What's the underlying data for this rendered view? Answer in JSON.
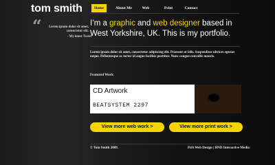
{
  "site": {
    "brand": "tom smith"
  },
  "sidebar": {
    "tweet_quote_icon": "quote-icon",
    "tweet_text": "Lorem ipsum dolor sit amet, consectetur elit.",
    "tweet_author": "- My latest Tweet"
  },
  "nav": {
    "items": [
      {
        "label": "Home",
        "active": true
      },
      {
        "label": "About Me"
      },
      {
        "label": "Web"
      },
      {
        "label": "Print"
      },
      {
        "label": "Contact"
      }
    ]
  },
  "hero": {
    "part1": "I’m a ",
    "highlight1": "graphic",
    "part2": " and ",
    "highlight2": "web designer",
    "part3": " based in West Yorkshire, UK. This is my portfolio."
  },
  "intro": "Lorem ipsum dolor sit amet, consectetur adipiscing elit. Praesent ut felis. Suspendisse ultrices egestas neque. Pellentesque ac tortor id augue facilisis porttitor. Nunc congue convallis mauris.",
  "featured": {
    "label": "Featured Work",
    "title": "CD Artwork",
    "subtitle": "BEATSYSTEM 2297"
  },
  "buttons": {
    "web": "View more web work >",
    "print": "View more print work >"
  },
  "footer": {
    "copyright": "© Tom Smith 2009.",
    "credit": "PdA Web Design | HND Interactive Media"
  },
  "colors": {
    "accent": "#f5d400",
    "background": "#0d0d0d"
  }
}
